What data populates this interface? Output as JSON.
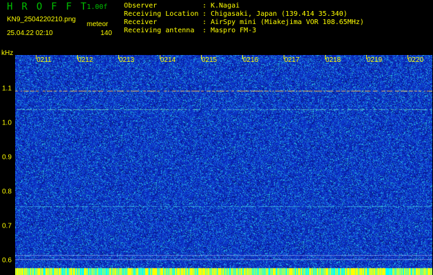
{
  "header": {
    "app_title": "HROFFT",
    "version": "1.00f",
    "filename": "KN9_2504220210.png",
    "datetime": "25.04.22 02:10",
    "meteor_label": "meteor",
    "meteor_count": "140"
  },
  "info": [
    {
      "key": "Observer",
      "value": "K.Nagai"
    },
    {
      "key": "Receiving Location",
      "value": "Chigasaki, Japan (139.414 35.340)"
    },
    {
      "key": "Receiver",
      "value": "AirSpy mini (Miakejima VOR 108.65MHz)"
    },
    {
      "key": "Receiving antenna",
      "value": "Maspro FM-3"
    }
  ],
  "axis": {
    "unit": "kHz",
    "y_ticks": [
      "1.1",
      "1.0",
      "0.9",
      "0.8",
      "0.7",
      "0.6"
    ],
    "x_ticks": [
      "0211",
      "0212",
      "0213",
      "0214",
      "0215",
      "0216",
      "0217",
      "0218",
      "0219",
      "0220"
    ]
  },
  "colors": {
    "background": "#000000",
    "label": "#ffff00",
    "title": "#00c000",
    "spectrogram_base": "#0a2ec8"
  }
}
